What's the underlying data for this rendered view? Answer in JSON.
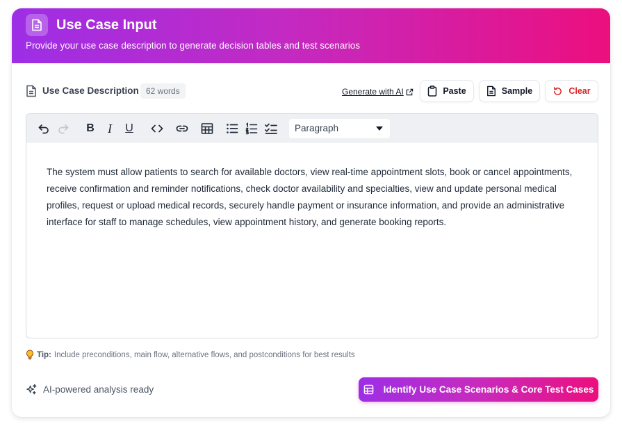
{
  "header": {
    "title": "Use Case Input",
    "subtitle": "Provide your use case description to generate decision tables and test scenarios",
    "icon": "document-icon"
  },
  "section": {
    "label": "Use Case Description",
    "word_count": "62 words",
    "generate_ai": "Generate with AI",
    "paste_label": "Paste",
    "sample_label": "Sample",
    "clear_label": "Clear"
  },
  "toolbar": {
    "block_type": "Paragraph",
    "icons": [
      "undo-icon",
      "redo-icon",
      "bold-icon",
      "italic-icon",
      "underline-icon",
      "code-icon",
      "link-icon",
      "table-icon",
      "bullet-list-icon",
      "numbered-list-icon",
      "checklist-icon"
    ]
  },
  "editor": {
    "text": "The system must allow patients to search for available doctors, view real-time appointment slots, book or cancel appointments, receive confirmation and reminder notifications, check doctor availability and specialties, view and update personal medical profiles, request or upload medical records, securely handle payment or insurance information, and provide an administrative interface for staff to manage schedules, view appointment history, and generate booking reports."
  },
  "footer": {
    "tip_label": "Tip:",
    "tip_text": "Include preconditions, main flow, alternative flows, and postconditions for best results",
    "status": "AI-powered analysis ready",
    "cta_label": "Identify Use Case Scenarios & Core Test Cases"
  },
  "colors": {
    "gradient_start": "#9d2ee6",
    "gradient_end": "#ec0f7e",
    "danger": "#dc2626"
  }
}
